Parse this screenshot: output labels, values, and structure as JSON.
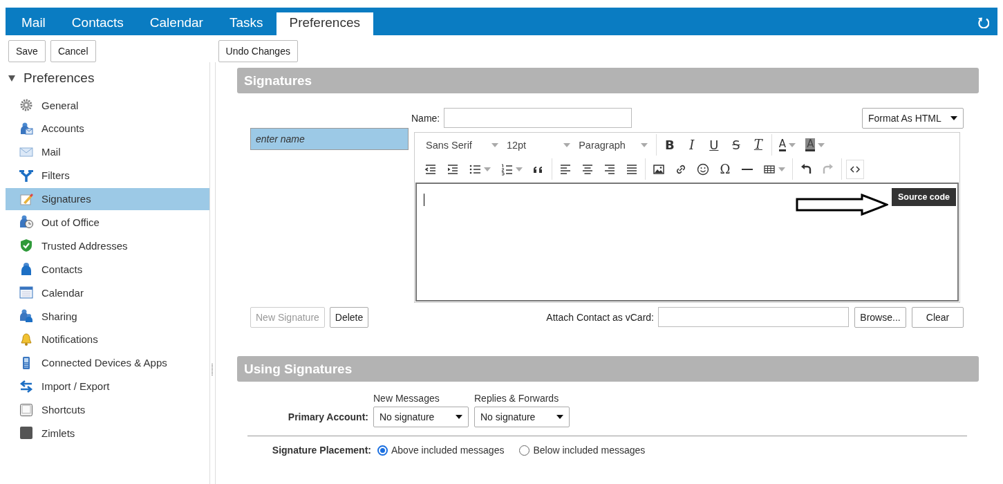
{
  "app_tabs": [
    {
      "label": "Mail",
      "selected": false
    },
    {
      "label": "Contacts",
      "selected": false
    },
    {
      "label": "Calendar",
      "selected": false
    },
    {
      "label": "Tasks",
      "selected": false
    },
    {
      "label": "Preferences",
      "selected": true
    }
  ],
  "toolbar": {
    "left_buttons": [
      "Save",
      "Cancel"
    ],
    "right_buttons": [
      "Undo Changes"
    ]
  },
  "sidebar": {
    "title": "Preferences",
    "expanded": true,
    "items": [
      {
        "label": "General",
        "kind": "gear",
        "selected": false
      },
      {
        "label": "Accounts",
        "kind": "accounts",
        "selected": false
      },
      {
        "label": "Mail",
        "kind": "mail",
        "selected": false
      },
      {
        "label": "Filters",
        "kind": "filters",
        "selected": false
      },
      {
        "label": "Signatures",
        "kind": "signatures",
        "selected": true
      },
      {
        "label": "Out of Office",
        "kind": "outofoffice",
        "selected": false
      },
      {
        "label": "Trusted Addresses",
        "kind": "trusted",
        "selected": false
      },
      {
        "label": "Contacts",
        "kind": "contacts",
        "selected": false
      },
      {
        "label": "Calendar",
        "kind": "calendar",
        "selected": false
      },
      {
        "label": "Sharing",
        "kind": "sharing",
        "selected": false
      },
      {
        "label": "Notifications",
        "kind": "notifications",
        "selected": false
      },
      {
        "label": "Connected Devices & Apps",
        "kind": "devices",
        "selected": false
      },
      {
        "label": "Import / Export",
        "kind": "importexport",
        "selected": false
      },
      {
        "label": "Shortcuts",
        "kind": "shortcuts",
        "selected": false
      },
      {
        "label": "Zimlets",
        "kind": "zimlets",
        "selected": false
      }
    ]
  },
  "signatures": {
    "title": "Signatures",
    "list": [
      {
        "label": "enter name",
        "selected": true
      }
    ],
    "name_label": "Name:",
    "format": "Format As HTML",
    "editor": {
      "dropdowns": [
        "Sans Serif",
        "12pt",
        "Paragraph"
      ],
      "rows": [
        [
          [
            {
              "kind": "bold",
              "glyph": "B",
              "disabled": false
            },
            {
              "kind": "italic",
              "glyph": "I",
              "disabled": false
            },
            {
              "kind": "underline",
              "glyph": "U",
              "disabled": false
            },
            {
              "kind": "strike",
              "glyph": "S",
              "disabled": false
            },
            {
              "kind": "clearformat",
              "glyph": "T",
              "disabled": false
            }
          ],
          [
            {
              "kind": "textcolor",
              "glyph": "A",
              "disabled": false
            },
            {
              "kind": "bgcolor",
              "glyph": "A",
              "disabled": false
            }
          ]
        ],
        [
          [
            {
              "kind": "outdent",
              "disabled": false
            },
            {
              "kind": "indent",
              "disabled": false
            },
            {
              "kind": "bullets",
              "disabled": false
            },
            {
              "kind": "numbers",
              "disabled": false
            },
            {
              "kind": "quote",
              "disabled": false
            }
          ],
          [
            {
              "kind": "alignleft",
              "disabled": false
            },
            {
              "kind": "aligncenter",
              "disabled": false
            },
            {
              "kind": "alignright",
              "disabled": false
            },
            {
              "kind": "justify",
              "disabled": false
            }
          ],
          [
            {
              "kind": "image",
              "disabled": false
            },
            {
              "kind": "link",
              "disabled": false
            },
            {
              "kind": "emoji",
              "disabled": false
            },
            {
              "kind": "omega",
              "glyph": "Ω",
              "disabled": false
            },
            {
              "kind": "hr",
              "disabled": false
            },
            {
              "kind": "table",
              "disabled": false
            }
          ],
          [
            {
              "kind": "undo",
              "disabled": false
            },
            {
              "kind": "redo",
              "disabled": true
            }
          ],
          [
            {
              "kind": "source",
              "disabled": false,
              "tooltip": "Source code"
            }
          ]
        ]
      ]
    },
    "buttons": [
      {
        "label": "New Signature",
        "disabled": true
      },
      {
        "label": "Delete",
        "disabled": false
      }
    ],
    "vcard_label": "Attach Contact as vCard:",
    "vcard_buttons": [
      "Browse...",
      "Clear"
    ]
  },
  "using": {
    "title": "Using Signatures",
    "columns": [
      "New Messages",
      "Replies & Forwards"
    ],
    "account_label": "Primary Account:",
    "selects": [
      "No signature",
      "No signature"
    ],
    "placement_label": "Signature Placement:",
    "placement": [
      {
        "label": "Above included messages",
        "selected": true
      },
      {
        "label": "Below included messages",
        "selected": false
      }
    ]
  }
}
